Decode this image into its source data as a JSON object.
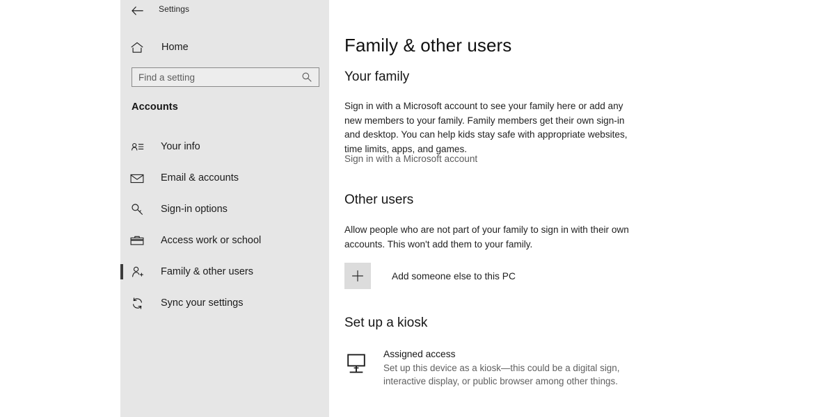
{
  "window": {
    "app_title": "Settings",
    "back_icon": "back-arrow-icon"
  },
  "sidebar": {
    "home_label": "Home",
    "home_icon": "home-icon",
    "search": {
      "placeholder": "Find a setting",
      "value": "",
      "icon": "search-icon"
    },
    "section_header": "Accounts",
    "items": [
      {
        "label": "Your info",
        "icon": "contact-card-icon",
        "selected": false
      },
      {
        "label": "Email & accounts",
        "icon": "envelope-icon",
        "selected": false
      },
      {
        "label": "Sign-in options",
        "icon": "key-icon",
        "selected": false
      },
      {
        "label": "Access work or school",
        "icon": "briefcase-icon",
        "selected": false
      },
      {
        "label": "Family & other users",
        "icon": "person-add-icon",
        "selected": true
      },
      {
        "label": "Sync your settings",
        "icon": "sync-icon",
        "selected": false
      }
    ]
  },
  "main": {
    "page_title": "Family & other users",
    "your_family": {
      "heading": "Your family",
      "description": "Sign in with a Microsoft account to see your family here or add any new members to your family. Family members get their own sign-in and desktop. You can help kids stay safe with appropriate websites, time limits, apps, and games.",
      "link": "Sign in with a Microsoft account"
    },
    "other_users": {
      "heading": "Other users",
      "description": "Allow people who are not part of your family to sign in with their own accounts. This won't add them to your family.",
      "add_button_icon": "plus-icon",
      "add_label": "Add someone else to this PC"
    },
    "kiosk": {
      "heading": "Set up a kiosk",
      "icon": "monitor-stand-icon",
      "title": "Assigned access",
      "description": "Set up this device as a kiosk—this could be a digital sign, interactive display, or public browser among other things."
    }
  },
  "colors": {
    "sidebar_bg": "#e6e6e6",
    "content_bg": "#ffffff",
    "selection_bar": "#3b3b3b",
    "muted_text": "#5f5f5f"
  }
}
